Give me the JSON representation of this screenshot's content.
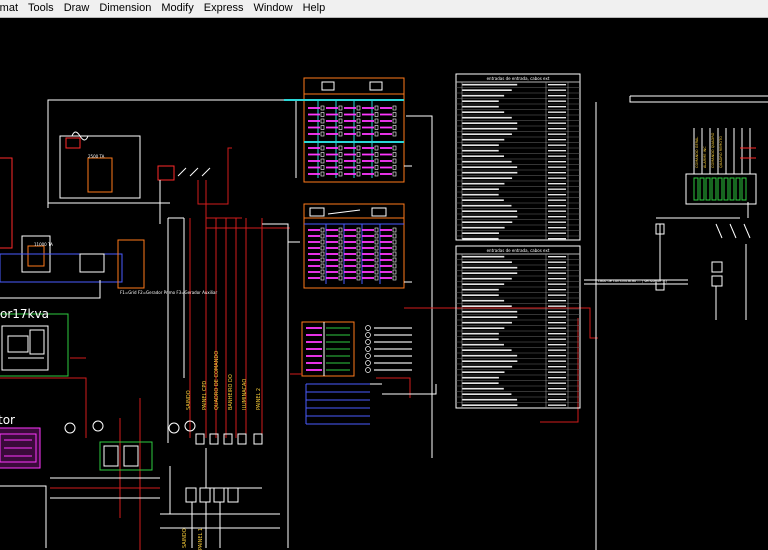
{
  "menubar": {
    "items": [
      "rmat",
      "Tools",
      "Draw",
      "Dimension",
      "Modify",
      "Express",
      "Window",
      "Help"
    ]
  },
  "drawing": {
    "label_kva": "or17kva",
    "label_generator": "tor",
    "label_group1": "F1=Grid\nF2=Gerador Primo\nF3=Gerador Auxiliar",
    "table1_title": "entradas de entrada, cabos ext",
    "table2_title": "entradas de entrada, cabos ext",
    "label_2500": "2500 TA",
    "label_11000": "11000 TA",
    "colors": {
      "white": "#ffffff",
      "red": "#ff2a2a",
      "orange": "#ff7a1a",
      "cyan": "#2ad7d7",
      "magenta": "#ff37ff",
      "blue": "#4a5cff",
      "green": "#2ecc40",
      "yellow": "#ffd23a",
      "wire_red": "#d21c1c"
    }
  }
}
